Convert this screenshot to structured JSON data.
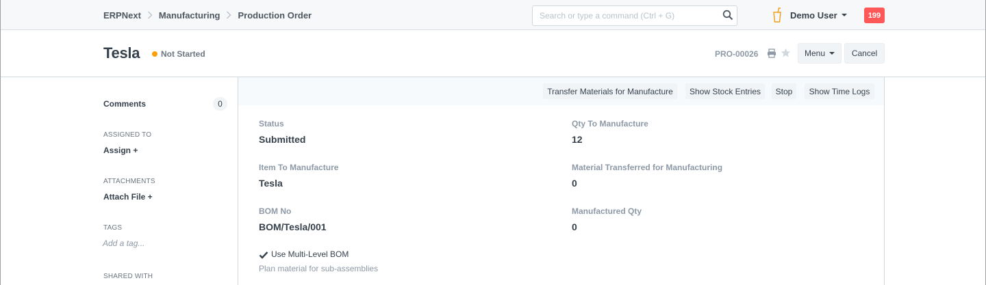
{
  "navbar": {
    "breadcrumbs": [
      "ERPNext",
      "Manufacturing",
      "Production Order"
    ],
    "search_placeholder": "Search or type a command (Ctrl + G)",
    "user_name": "Demo User",
    "notification_count": "199",
    "icons": {
      "search": "search-icon",
      "app": "cup-icon",
      "separator": "chevron-right-icon"
    }
  },
  "page_head": {
    "title": "Tesla",
    "status": "Not Started",
    "status_color": "#ffa00a",
    "doc_id": "PRO-00026",
    "menu_label": "Menu",
    "cancel_label": "Cancel"
  },
  "sidebar": {
    "comments_label": "Comments",
    "comments_count": "0",
    "assigned_to_label": "ASSIGNED TO",
    "assign_action": "Assign +",
    "attachments_label": "ATTACHMENTS",
    "attach_action": "Attach File +",
    "tags_label": "TAGS",
    "tag_placeholder": "Add a tag...",
    "shared_with_label": "SHARED WITH"
  },
  "toolbar": {
    "buttons": [
      "Transfer Materials for Manufacture",
      "Show Stock Entries",
      "Stop",
      "Show Time Logs"
    ]
  },
  "form": {
    "left": [
      {
        "label": "Status",
        "value": "Submitted"
      },
      {
        "label": "Item To Manufacture",
        "value": "Tesla"
      },
      {
        "label": "BOM No",
        "value": "BOM/Tesla/001"
      }
    ],
    "right": [
      {
        "label": "Qty To Manufacture",
        "value": "12"
      },
      {
        "label": "Material Transferred for Manufacturing",
        "value": "0"
      },
      {
        "label": "Manufactured Qty",
        "value": "0"
      }
    ],
    "checkbox_label": "Use Multi-Level BOM",
    "checkbox_checked": true,
    "checkbox_help": "Plan material for sub-assemblies"
  }
}
